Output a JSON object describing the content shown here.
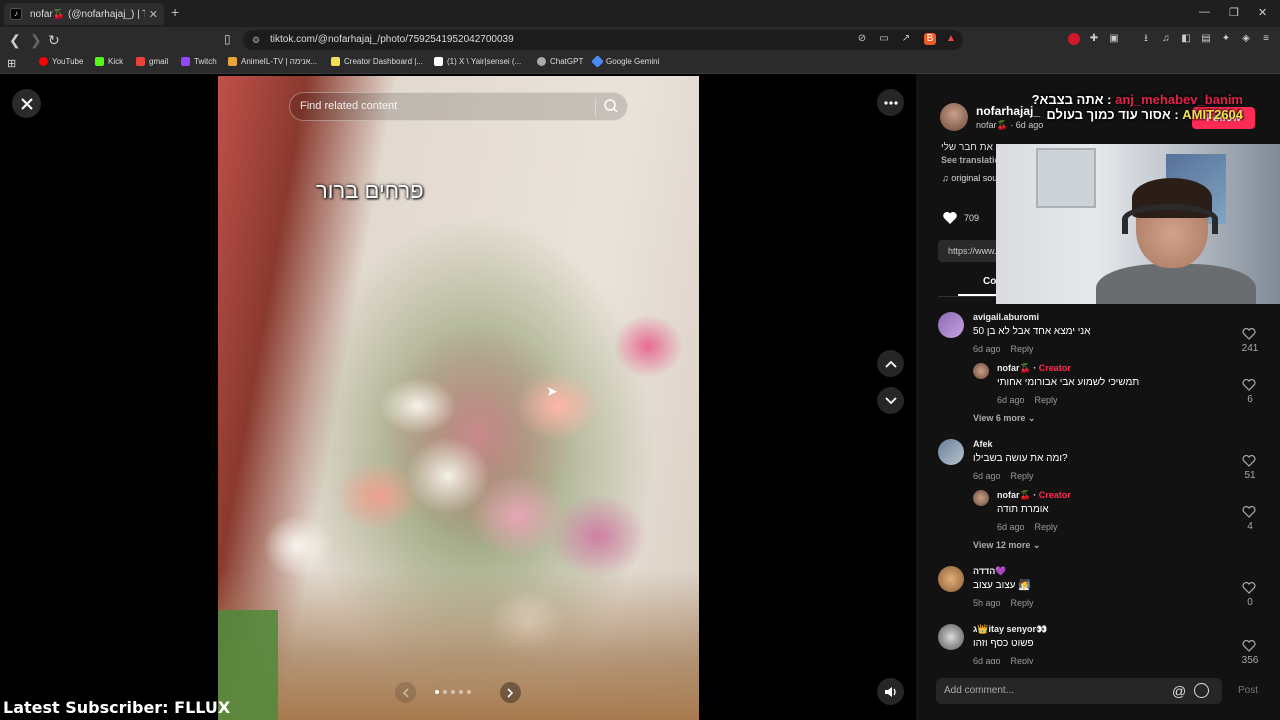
{
  "browser": {
    "tab_title": "nofar🍒 (@nofarhajaj_) | TikT...",
    "url": "tiktok.com/@nofarhajaj_/photo/7592541952042700039",
    "bookmarks": [
      {
        "label": "YouTube",
        "color": "#ff0000"
      },
      {
        "label": "Kick",
        "color": "#53fc18"
      },
      {
        "label": "gmail",
        "color": "#ea4335"
      },
      {
        "label": "Twitch",
        "color": "#9146ff"
      },
      {
        "label": "AnimeIL-TV | אנימה...",
        "color": "#e8a33d"
      },
      {
        "label": "Creator Dashboard |...",
        "color": "#f4e04d"
      },
      {
        "label": "(1) X \\ Yair|sensei (...",
        "color": "#ffffff"
      },
      {
        "label": "ChatGPT",
        "color": "#aaaaaa"
      },
      {
        "label": "Google Gemini",
        "color": "#4a8af4"
      }
    ]
  },
  "viewer": {
    "search_placeholder": "Find related content",
    "photo_caption": "פרחים ברור",
    "carousel_pages": 5,
    "carousel_active": 1
  },
  "stream_overlay": {
    "latest_subscriber": "Latest Subscriber: FLLUX",
    "chat_line1_user": "anj_mehabev_banim",
    "chat_line1_text": "אתה בצבא?",
    "chat_line2_user": "AMIT2604",
    "chat_line2_text": "אסור עוד כמוך בעולם"
  },
  "post": {
    "author_name": "nofarhajaj_",
    "author_sub": "nofar🍒 · 6d ago",
    "follow_label": "Follow",
    "description": "את חבר שלי",
    "see_translation": "See translation",
    "music": "original sound",
    "likes": "709",
    "link": "https://www.tiktok.com",
    "comments_tab": "Comments"
  },
  "comments": [
    {
      "name": "avigail.aburomi",
      "text": "אני ימצא אחד אבל לא בן 50",
      "time": "6d ago",
      "reply": "Reply",
      "likes": "241"
    },
    {
      "name": "nofar🍒",
      "creator": "Creator",
      "text": "תמשיכי לשמוע אבי אבורומי אחותי",
      "time": "6d ago",
      "reply": "Reply",
      "likes": "6"
    },
    {
      "view_more": "View 6 more"
    },
    {
      "name": "Afek",
      "text": "ומה את עושה בשבילו?",
      "time": "6d ago",
      "reply": "Reply",
      "likes": "51"
    },
    {
      "name": "nofar🍒",
      "creator": "Creator",
      "text": "אומרת תודה",
      "time": "6d ago",
      "reply": "Reply",
      "likes": "4"
    },
    {
      "view_more": "View 12 more"
    },
    {
      "name": "הדדה💜",
      "text": "עצוב עצוב 🧖",
      "time": "5h ago",
      "reply": "Reply",
      "likes": "0"
    },
    {
      "name": "ג👑itay senyor👀",
      "text": "פשוט כסף וזהו",
      "time": "6d ago",
      "reply": "Reply",
      "likes": "356"
    }
  ],
  "composer": {
    "placeholder": "Add comment...",
    "post_label": "Post"
  }
}
